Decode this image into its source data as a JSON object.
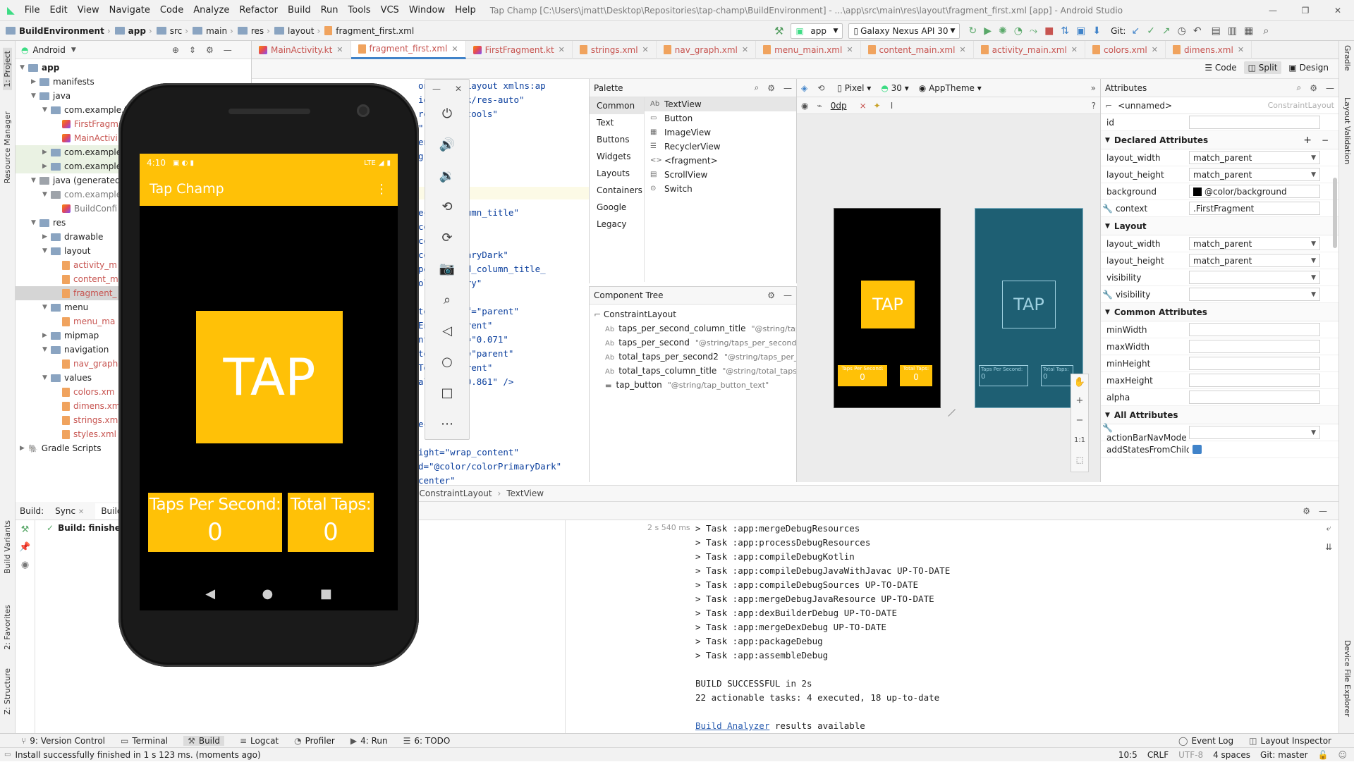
{
  "titlebar": {
    "menus": [
      "File",
      "Edit",
      "View",
      "Navigate",
      "Code",
      "Analyze",
      "Refactor",
      "Build",
      "Run",
      "Tools",
      "VCS",
      "Window",
      "Help"
    ],
    "title": "Tap Champ [C:\\Users\\jmatt\\Desktop\\Repositories\\tap-champ\\BuildEnvironment] - ...\\app\\src\\main\\res\\layout\\fragment_first.xml [app] - Android Studio"
  },
  "navbar": {
    "crumbs": [
      "BuildEnvironment",
      "app",
      "src",
      "main",
      "res",
      "layout",
      "fragment_first.xml"
    ],
    "run_config": "app",
    "device": "Galaxy Nexus API 30",
    "git_label": "Git:"
  },
  "stripes": {
    "left": [
      "1: Project",
      "Resource Manager",
      "Build Variants",
      "2: Favorites",
      "Z: Structure"
    ],
    "right": [
      "Gradle",
      "Layout Validation",
      "Device File Explorer"
    ]
  },
  "project": {
    "view_mode": "Android",
    "tree": [
      {
        "label": "app",
        "depth": 0,
        "type": "folder",
        "expanded": true,
        "bold": true
      },
      {
        "label": "manifests",
        "depth": 1,
        "type": "folder"
      },
      {
        "label": "java",
        "depth": 1,
        "type": "folder",
        "expanded": true
      },
      {
        "label": "com.example.t",
        "depth": 2,
        "type": "folder",
        "expanded": true
      },
      {
        "label": "FirstFragm",
        "depth": 3,
        "type": "kt",
        "color": "#c75450"
      },
      {
        "label": "MainActivi",
        "depth": 3,
        "type": "kt",
        "color": "#c75450"
      },
      {
        "label": "com.example",
        "depth": 2,
        "type": "folder",
        "hl": true
      },
      {
        "label": "com.example",
        "depth": 2,
        "type": "folder",
        "hl": true
      },
      {
        "label": "java (generated)",
        "depth": 1,
        "type": "gfolder",
        "expanded": true
      },
      {
        "label": "com.example",
        "depth": 2,
        "type": "gfolder",
        "expanded": true,
        "color": "#7a7a7a"
      },
      {
        "label": "BuildConfi",
        "depth": 3,
        "type": "kt",
        "color": "#7a7a7a"
      },
      {
        "label": "res",
        "depth": 1,
        "type": "folder",
        "expanded": true
      },
      {
        "label": "drawable",
        "depth": 2,
        "type": "folder"
      },
      {
        "label": "layout",
        "depth": 2,
        "type": "folder",
        "expanded": true
      },
      {
        "label": "activity_m",
        "depth": 3,
        "type": "xml",
        "color": "#c75450"
      },
      {
        "label": "content_m",
        "depth": 3,
        "type": "xml",
        "color": "#c75450"
      },
      {
        "label": "fragment_",
        "depth": 3,
        "type": "xml",
        "color": "#c75450",
        "selected": true
      },
      {
        "label": "menu",
        "depth": 2,
        "type": "folder",
        "expanded": true
      },
      {
        "label": "menu_ma",
        "depth": 3,
        "type": "xml",
        "color": "#c75450"
      },
      {
        "label": "mipmap",
        "depth": 2,
        "type": "folder"
      },
      {
        "label": "navigation",
        "depth": 2,
        "type": "folder",
        "expanded": true
      },
      {
        "label": "nav_graph",
        "depth": 3,
        "type": "xml",
        "color": "#c75450"
      },
      {
        "label": "values",
        "depth": 2,
        "type": "folder",
        "expanded": true
      },
      {
        "label": "colors.xm",
        "depth": 3,
        "type": "xml",
        "color": "#c75450"
      },
      {
        "label": "dimens.xm",
        "depth": 3,
        "type": "xml",
        "color": "#c75450"
      },
      {
        "label": "strings.xm",
        "depth": 3,
        "type": "xml",
        "color": "#c75450"
      },
      {
        "label": "styles.xml",
        "depth": 3,
        "type": "xml",
        "color": "#c75450"
      },
      {
        "label": "Gradle Scripts",
        "depth": 0,
        "type": "gradle"
      }
    ]
  },
  "tabs": [
    {
      "label": "MainActivity.kt",
      "type": "kt"
    },
    {
      "label": "fragment_first.xml",
      "type": "xml",
      "active": true
    },
    {
      "label": "FirstFragment.kt",
      "type": "kt"
    },
    {
      "label": "strings.xml",
      "type": "xml"
    },
    {
      "label": "nav_graph.xml",
      "type": "xml"
    },
    {
      "label": "menu_main.xml",
      "type": "xml"
    },
    {
      "label": "content_main.xml",
      "type": "xml"
    },
    {
      "label": "activity_main.xml",
      "type": "xml"
    },
    {
      "label": "colors.xml",
      "type": "xml"
    },
    {
      "label": "dimens.xml",
      "type": "xml"
    }
  ],
  "view_modes": [
    "Code",
    "Split",
    "Design"
  ],
  "code_lines": [
    {
      "a": "onstraintLayout xmlns:ap",
      "b": ""
    },
    {
      "a": "id.com/apk/res-auto\"",
      "b": ""
    },
    {
      "a": "roid.com/tools\"",
      "b": ""
    },
    {
      "a": "\"",
      "b": ""
    },
    {
      "a": "ent\"",
      "b": ""
    },
    {
      "a": "ground\"",
      "b": ""
    },
    {
      "a": "",
      "b": ""
    },
    {
      "a": "",
      "b": ""
    },
    {
      "a": "",
      "b": ""
    },
    {
      "a": "econd_column_title\"",
      "b": ""
    },
    {
      "a": "content\"",
      "b": ""
    },
    {
      "a": "content\"",
      "b": ""
    },
    {
      "a": "colorPrimaryDark\"",
      "b": ""
    },
    {
      "a": "per_second_column_title_",
      "b": ""
    },
    {
      "a": "olorPrimary\"",
      "b": ""
    },
    {
      "a": "",
      "b": ""
    },
    {
      "a": "toBottomOf=\"parent\"",
      "b": ""
    },
    {
      "a": "EndOf=\"parent\"",
      "b": ""
    },
    {
      "a": "ntal_bias=\"0.071\"",
      "b": ""
    },
    {
      "a": "toStartOf=\"parent\"",
      "b": ""
    },
    {
      "a": "TopOf=\"parent\"",
      "b": ""
    },
    {
      "a": "al_bias=\"0.861\" />",
      "b": ""
    },
    {
      "a": "",
      "b": ""
    },
    {
      "a": "",
      "b": ""
    },
    {
      "a": "econd\"",
      "b": ""
    },
    {
      "a": "",
      "b": ""
    },
    {
      "a": "ight=\"wrap_content\"",
      "b": ""
    },
    {
      "a": "d=\"@color/colorPrimaryDark\"",
      "b": ""
    },
    {
      "a": "center\"",
      "b": ""
    }
  ],
  "palette": {
    "title": "Palette",
    "categories": [
      "Common",
      "Text",
      "Buttons",
      "Widgets",
      "Layouts",
      "Containers",
      "Google",
      "Legacy"
    ],
    "items": [
      {
        "glyph": "Ab",
        "label": "TextView"
      },
      {
        "glyph": "▭",
        "label": "Button"
      },
      {
        "glyph": "▦",
        "label": "ImageView"
      },
      {
        "glyph": "☰",
        "label": "RecyclerView"
      },
      {
        "glyph": "<>",
        "label": "<fragment>"
      },
      {
        "glyph": "▤",
        "label": "ScrollView"
      },
      {
        "glyph": "⊙",
        "label": "Switch"
      }
    ]
  },
  "component_tree": {
    "title": "Component Tree",
    "root": "ConstraintLayout",
    "rows": [
      {
        "glyph": "Ab",
        "id": "taps_per_second_column_title",
        "ref": "\"@string/tap..."
      },
      {
        "glyph": "Ab",
        "id": "taps_per_second",
        "ref": "\"@string/taps_per_second..."
      },
      {
        "glyph": "Ab",
        "id": "total_taps_per_second2",
        "ref": "\"@string/taps_per_secon..."
      },
      {
        "glyph": "Ab",
        "id": "total_taps_column_title",
        "ref": "\"@string/total_taps..."
      },
      {
        "glyph": "▬",
        "id": "tap_button",
        "ref": "\"@string/tap_button_text\""
      }
    ]
  },
  "design_toolbar": {
    "device": "Pixel",
    "api": "30",
    "theme": "AppTheme",
    "margin": "0dp"
  },
  "design_preview": {
    "tap": "TAP",
    "taps_per_second": "Taps Per Second:",
    "total_taps": "Total Taps:",
    "zero": "0",
    "zoom_fit": "1:1"
  },
  "attributes": {
    "title": "Attributes",
    "component_name": "<unnamed>",
    "component_type": "ConstraintLayout",
    "id_label": "id",
    "declared_title": "Declared Attributes",
    "declared": [
      {
        "k": "layout_width",
        "v": "match_parent",
        "dd": true
      },
      {
        "k": "layout_height",
        "v": "match_parent",
        "dd": true
      },
      {
        "k": "background",
        "v": "@color/background",
        "swatch": true
      },
      {
        "k": "context",
        "v": ".FirstFragment",
        "tool": true
      }
    ],
    "layout_title": "Layout",
    "layout": [
      {
        "k": "layout_width",
        "v": "match_parent",
        "dd": true
      },
      {
        "k": "layout_height",
        "v": "match_parent",
        "dd": true
      },
      {
        "k": "visibility",
        "v": "",
        "dd": true
      },
      {
        "k": "visibility",
        "v": "",
        "dd": true,
        "tool": true
      }
    ],
    "common_title": "Common Attributes",
    "common": [
      {
        "k": "minWidth",
        "v": ""
      },
      {
        "k": "maxWidth",
        "v": ""
      },
      {
        "k": "minHeight",
        "v": ""
      },
      {
        "k": "maxHeight",
        "v": ""
      },
      {
        "k": "alpha",
        "v": ""
      }
    ],
    "all_title": "All Attributes",
    "all": [
      {
        "k": "actionBarNavMode",
        "v": "",
        "dd": true,
        "tool": true
      },
      {
        "k": "addStatesFromChild...",
        "v": "",
        "check": true
      }
    ]
  },
  "design_crumb": [
    "t.ConstraintLayout",
    "TextView"
  ],
  "build": {
    "tabs": [
      "Build:",
      "Sync",
      "Build"
    ],
    "status": "Build: finished",
    "time": "2 s 540 ms",
    "log": [
      "> Task :app:mergeDebugResources",
      "> Task :app:processDebugResources",
      "> Task :app:compileDebugKotlin",
      "> Task :app:compileDebugJavaWithJavac UP-TO-DATE",
      "> Task :app:compileDebugSources UP-TO-DATE",
      "> Task :app:mergeDebugJavaResource UP-TO-DATE",
      "> Task :app:dexBuilderDebug UP-TO-DATE",
      "> Task :app:mergeDexDebug UP-TO-DATE",
      "> Task :app:packageDebug",
      "> Task :app:assembleDebug",
      "",
      "BUILD SUCCESSFUL in 2s",
      "22 actionable tasks: 4 executed, 18 up-to-date",
      ""
    ],
    "analyzer_link": "Build Analyzer",
    "analyzer_rest": " results available"
  },
  "bottom_tools": [
    {
      "glyph": "⑂",
      "label": "9: Version Control"
    },
    {
      "glyph": "▭",
      "label": "Terminal"
    },
    {
      "glyph": "⚒",
      "label": "Build",
      "active": true
    },
    {
      "glyph": "≡",
      "label": "Logcat"
    },
    {
      "glyph": "◔",
      "label": "Profiler"
    },
    {
      "glyph": "▶",
      "label": "4: Run"
    },
    {
      "glyph": "☰",
      "label": "6: TODO"
    }
  ],
  "bottom_right_tools": [
    {
      "glyph": "◯",
      "label": "Event Log"
    },
    {
      "glyph": "◫",
      "label": "Layout Inspector"
    }
  ],
  "status": {
    "message": "Install successfully finished in 1 s 123 ms. (moments ago)",
    "position": "10:5",
    "line_sep": "CRLF",
    "encoding": "UTF-8",
    "indent": "4 spaces",
    "git": "Git: master"
  },
  "emulator": {
    "time": "4:10",
    "network": "LTE",
    "app_title": "Tap Champ",
    "tap": "TAP",
    "taps_per_second": "Taps Per Second:",
    "total_taps": "Total Taps:",
    "taps_value": "0",
    "total_value": "0"
  },
  "colors": {
    "accent": "#ffc107",
    "primary_dark": "#ffa000",
    "blueprint": "#1e5f73",
    "link": "#2a5db0",
    "success": "#59a869"
  }
}
